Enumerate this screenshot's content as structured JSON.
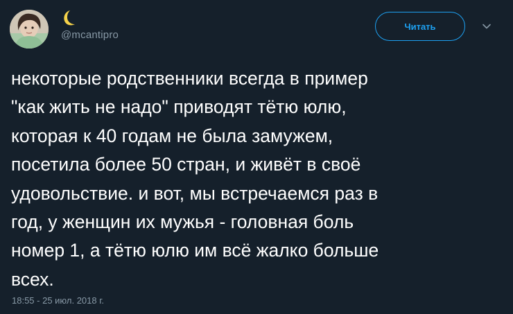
{
  "author": {
    "handle": "@mcantipro",
    "display_name_icon": "crescent-moon-icon"
  },
  "follow_button": {
    "label": "Читать"
  },
  "menu": {
    "icon": "chevron-down-icon"
  },
  "tweet": {
    "lines": [
      "некоторые родственники всегда в пример",
      "\"как жить не надо\" приводят тётю юлю,",
      "которая к 40 годам не была замужем,",
      "посетила более 50 стран, и живёт в своё",
      "удовольствие. и вот, мы встречаемся раз в",
      "год, у женщин их мужья - головная боль",
      "номер 1, а тётю юлю им всё жалко больше",
      "всех."
    ],
    "timestamp": "18:55 - 25 июл. 2018 г."
  },
  "colors": {
    "background": "#15202b",
    "accent": "#1da1f2",
    "secondary_text": "#8899a6",
    "moon": "#f5d24a"
  }
}
